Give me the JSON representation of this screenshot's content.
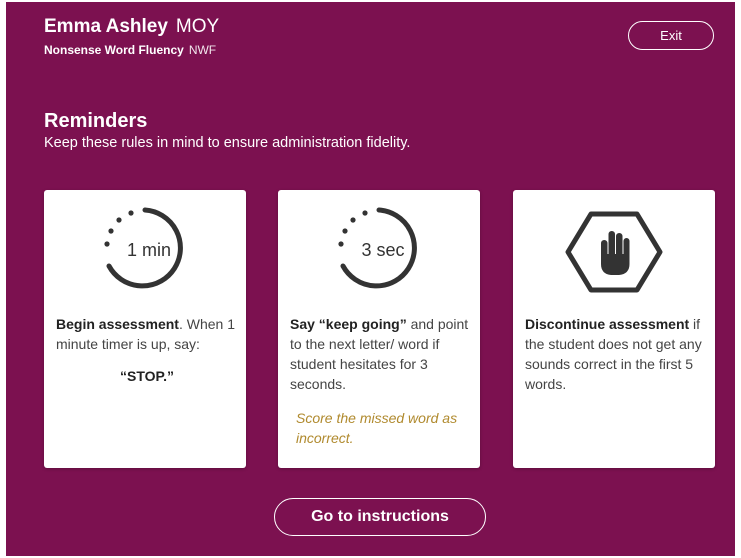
{
  "header": {
    "student_name": "Emma Ashley",
    "period": "MOY",
    "measure_name": "Nonsense Word Fluency",
    "measure_code": "NWF",
    "exit_label": "Exit"
  },
  "reminders": {
    "title": "Reminders",
    "subtitle": "Keep these rules in mind to ensure administration fidelity."
  },
  "cards": [
    {
      "icon": "timer-icon",
      "timer_label": "1 min",
      "bold": "Begin assessment",
      "text": ". When 1 minute timer is up, say:",
      "quote": "“STOP.”"
    },
    {
      "icon": "timer-icon",
      "timer_label": "3 sec",
      "bold": "Say “keep going”",
      "text": " and point to the next letter/ word if student hesitates for 3 seconds.",
      "note": "Score the missed word as incorrect."
    },
    {
      "icon": "stop-hand-icon",
      "bold": "Discontinue assessment",
      "text": " if the student does not get any sounds correct in the first 5 words."
    }
  ],
  "footer": {
    "go_label": "Go to instructions"
  },
  "colors": {
    "background": "#7c1150",
    "note": "#b08a2e",
    "icon": "#333333"
  }
}
